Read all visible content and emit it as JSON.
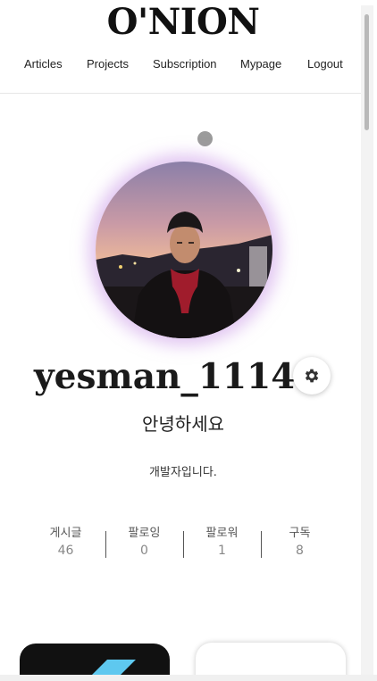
{
  "header": {
    "logo": "O'NION",
    "nav": [
      "Articles",
      "Projects",
      "Subscription",
      "Mypage",
      "Logout"
    ]
  },
  "profile": {
    "username": "yesman_1114",
    "greeting": "안녕하세요",
    "bio": "개발자입니다.",
    "settings_icon": "gear-icon"
  },
  "stats": [
    {
      "label": "게시글",
      "value": "46"
    },
    {
      "label": "팔로잉",
      "value": "0"
    },
    {
      "label": "팔로워",
      "value": "1"
    },
    {
      "label": "구독",
      "value": "8"
    }
  ],
  "colors": {
    "avatar_glow": "#c896e6",
    "card_dark": "#111111",
    "card_accent": "#5ec8ef"
  }
}
